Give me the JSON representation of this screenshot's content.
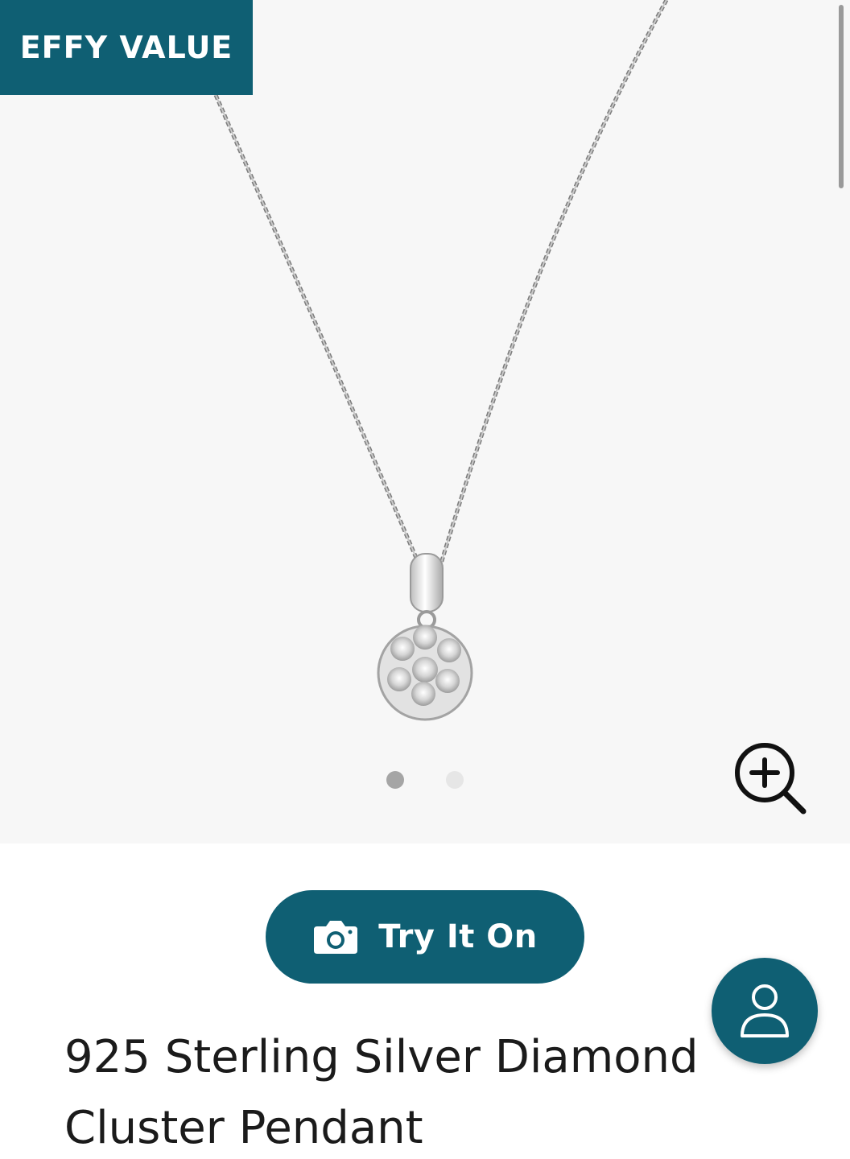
{
  "badge": {
    "label": "EFFY VALUE"
  },
  "gallery": {
    "image_subject": "silver diamond cluster pendant necklace",
    "slide_count": 2,
    "active_slide": 1,
    "zoom_icon": "zoom-in-icon"
  },
  "try_on": {
    "label": "Try It On",
    "icon": "camera-icon"
  },
  "account": {
    "icon": "user-icon"
  },
  "product": {
    "title": "925 Sterling Silver Diamond Cluster Pendant"
  },
  "colors": {
    "brand_teal": "#0f5f73",
    "gallery_bg": "#f7f7f7",
    "text": "#1b1b1b",
    "dot_active": "#a5a5a5",
    "dot_inactive": "#e6e6e6"
  }
}
